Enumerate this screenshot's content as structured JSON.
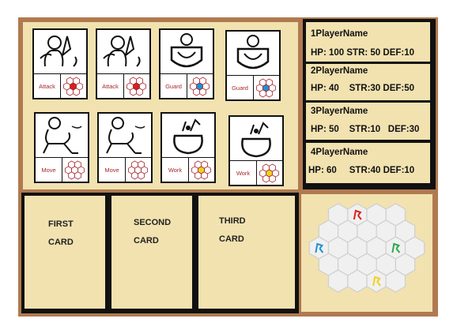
{
  "cards": [
    {
      "label": "Attack",
      "art": "attack-figure",
      "hex_color": "#d92020"
    },
    {
      "label": "Attack",
      "art": "attack-figure",
      "hex_color": "#d92020"
    },
    {
      "label": "Guard",
      "art": "guard-figure",
      "hex_color": "#1e90d6"
    },
    {
      "label": "Guard",
      "art": "guard-figure",
      "hex_color": "#1e90d6"
    },
    {
      "label": "Move",
      "art": "move-figure",
      "hex_color": "#ffffff"
    },
    {
      "label": "Move",
      "art": "move-figure",
      "hex_color": "#ffffff"
    },
    {
      "label": "Work",
      "art": "work-pot",
      "hex_color": "#f0d020"
    },
    {
      "label": "Work",
      "art": "work-pot",
      "hex_color": "#f0d020"
    }
  ],
  "players": [
    {
      "name": "1PlayerName",
      "stats": "HP: 100 STR: 50 DEF:10"
    },
    {
      "name": "2PlayerName",
      "stats": "HP: 40    STR:30 DEF:50"
    },
    {
      "name": "3PlayerName",
      "stats": "HP: 50    STR:10   DEF:30"
    },
    {
      "name": "4PlayerName",
      "stats": "HP: 60     STR:40 DEF:10"
    }
  ],
  "slots": [
    {
      "line1": "FIRST",
      "line2": "CARD"
    },
    {
      "line1": "SECOND",
      "line2": "CARD"
    },
    {
      "line1": "THIRD",
      "line2": "CARD"
    }
  ],
  "map": {
    "tokens": [
      {
        "color": "#d92020"
      },
      {
        "color": "#1e90d6"
      },
      {
        "color": "#2aa84a"
      },
      {
        "color": "#f0d020"
      }
    ]
  }
}
